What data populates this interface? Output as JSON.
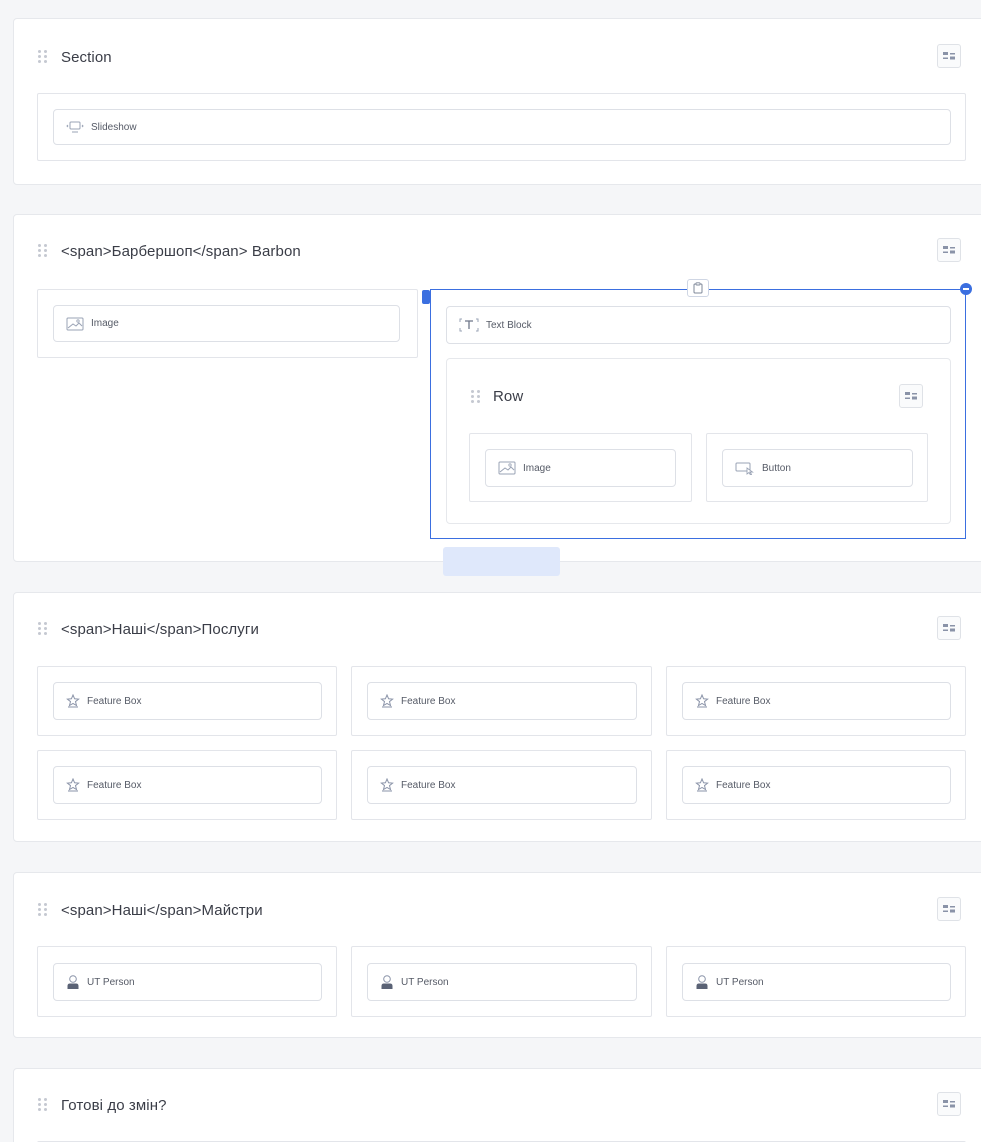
{
  "sections": [
    {
      "title": "Section"
    },
    {
      "title": "<span>Барбершоп</span> Barbon"
    },
    {
      "title": "<span>Наші</span>Послуги"
    },
    {
      "title": "<span>Наші</span>Майстри"
    },
    {
      "title": "Готові до змін?"
    }
  ],
  "elements": {
    "slideshow": "Slideshow",
    "image": "Image",
    "text_block": "Text Block",
    "row_title": "Row",
    "row_image": "Image",
    "button": "Button",
    "feature_box": "Feature Box",
    "ut_person": "UT Person"
  },
  "colors": {
    "accent": "#3b6fe0",
    "background": "#f5f6f8",
    "card": "#ffffff",
    "border": "#e3e5ea"
  },
  "icons": {
    "drag": "drag-handle-icon",
    "settings": "settings-sliders-icon",
    "slideshow": "slideshow-icon",
    "image": "image-icon",
    "text": "text-icon",
    "button": "button-cursor-icon",
    "feature": "star-icon",
    "person": "person-icon",
    "clipboard": "clipboard-icon"
  }
}
